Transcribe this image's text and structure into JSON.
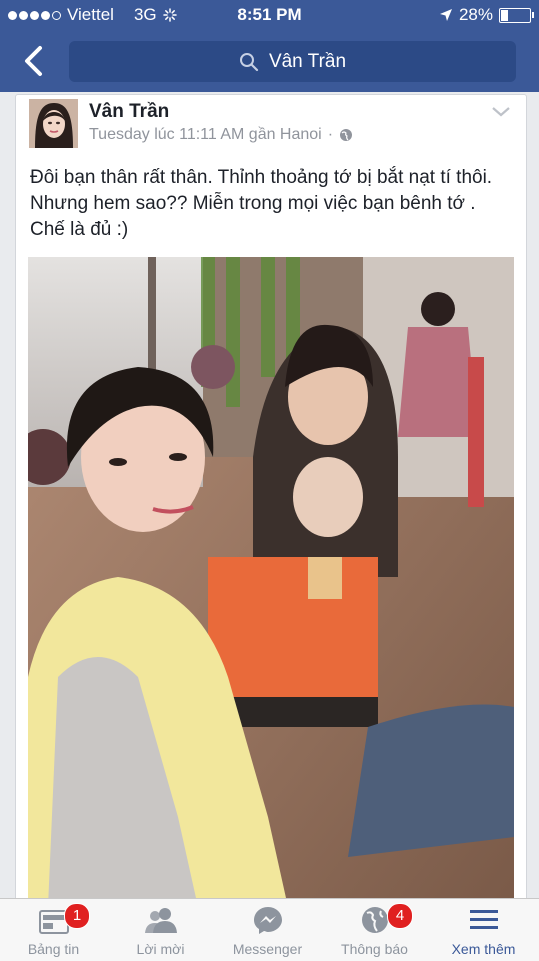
{
  "status_bar": {
    "carrier": "Viettel",
    "network": "3G",
    "time": "8:51 PM",
    "battery": "28%",
    "signal_bars": 4
  },
  "nav": {
    "search_text": "Vân Trần",
    "back_icon": "chevron-left-icon",
    "search_icon": "search-icon"
  },
  "post": {
    "author": "Vân Trần",
    "timestamp": "Tuesday lúc 11:11 AM gần Hanoi",
    "separator": "·",
    "privacy_icon": "globe-icon",
    "message": "Đôi bạn thân rất thân. Thỉnh thoảng tớ bị bắt nạt tí thôi. Nhưng hem sao?? Miễn trong mọi việc bạn bênh tớ . Chế là đủ :)"
  },
  "tab_bar": {
    "tabs": [
      {
        "label": "Bảng tin",
        "icon": "news-feed-icon",
        "badge": "1"
      },
      {
        "label": "Lời mời",
        "icon": "friend-requests-icon",
        "badge": ""
      },
      {
        "label": "Messenger",
        "icon": "messenger-icon",
        "badge": ""
      },
      {
        "label": "Thông báo",
        "icon": "globe-notifications-icon",
        "badge": "4"
      },
      {
        "label": "Xem thêm",
        "icon": "menu-icon",
        "badge": ""
      }
    ]
  },
  "colors": {
    "brand": "#3b5998",
    "badge": "#e02020",
    "inactive_tab": "#8d949e"
  }
}
